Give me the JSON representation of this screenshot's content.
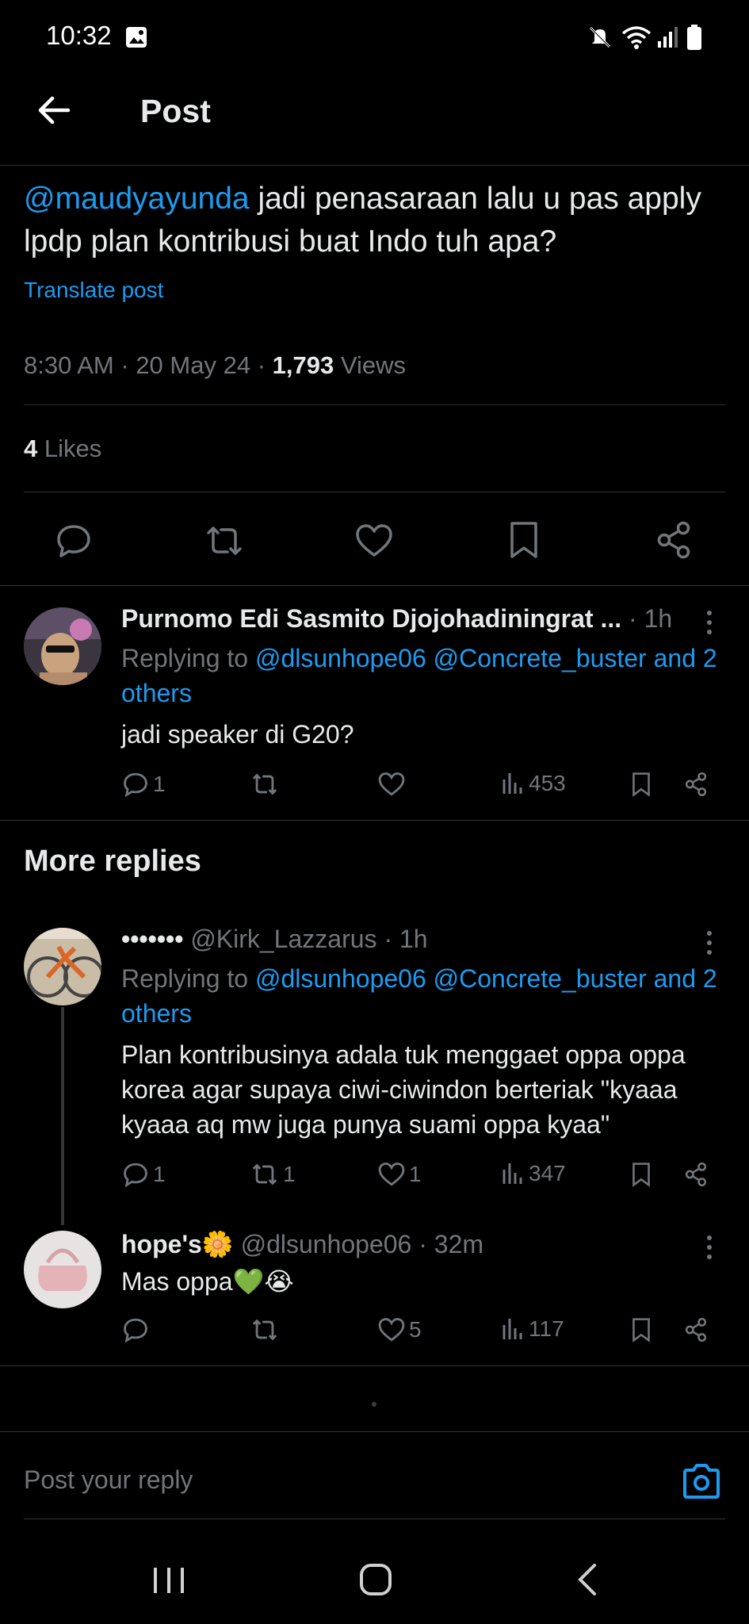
{
  "status_bar": {
    "time": "10:32",
    "icons": [
      "image-icon",
      "mute-icon",
      "wifi-icon",
      "signal-icon",
      "battery-icon"
    ]
  },
  "header": {
    "title": "Post",
    "back_icon": "arrow-left-icon"
  },
  "post": {
    "mention": "@maudyayunda",
    "text": " jadi penasaraan lalu u pas apply lpdp plan kontribusi buat Indo tuh apa?",
    "translate_label": "Translate post",
    "time": "8:30 AM",
    "sep1": " · ",
    "date": "20 May 24",
    "sep2": " · ",
    "views_count": "1,793",
    "views_label": " Views",
    "likes_count": "4",
    "likes_label": " Likes",
    "actions": [
      "reply-icon",
      "repost-icon",
      "like-icon",
      "bookmark-icon",
      "share-icon"
    ]
  },
  "reply1": {
    "name": "Purnomo Edi Sasmito Djojohadiningrat ...",
    "time": " · 1h",
    "replying_prefix": "Replying to ",
    "replying_targets": "@dlsunhope06 @Concrete_buster and 2 others",
    "text": "jadi speaker di G20?",
    "reply_count": "1",
    "repost_count": "",
    "like_count": "",
    "views": "453"
  },
  "more_replies": {
    "title": "More replies"
  },
  "reply2": {
    "name": "•••••••",
    "handle": " @Kirk_Lazzarus",
    "time": " · 1h",
    "replying_prefix": "Replying to ",
    "replying_targets": "@dlsunhope06 @Concrete_buster and 2 others",
    "text": "Plan kontribusinya adala tuk menggaet oppa oppa korea agar supaya ciwi-ciwindon berteriak \"kyaaa kyaaa aq mw juga punya suami oppa kyaa\"",
    "reply_count": "1",
    "repost_count": "1",
    "like_count": "1",
    "views": "347"
  },
  "reply3": {
    "name": "hope's",
    "name_emoji": "🌼",
    "handle": " @dlsunhope06",
    "time": " · 32m",
    "text": "Mas oppa💚😭",
    "reply_count": "",
    "repost_count": "",
    "like_count": "5",
    "views": "117"
  },
  "reply_box": {
    "placeholder": "Post your reply",
    "camera_icon": "camera-icon"
  },
  "nav_bar": {
    "icons": [
      "recent-apps-icon",
      "home-icon",
      "back-icon"
    ]
  },
  "colors": {
    "background": "#000000",
    "text": "#e7e9ea",
    "muted": "#71767b",
    "link": "#1d9bf0",
    "divider": "#2f3336"
  }
}
